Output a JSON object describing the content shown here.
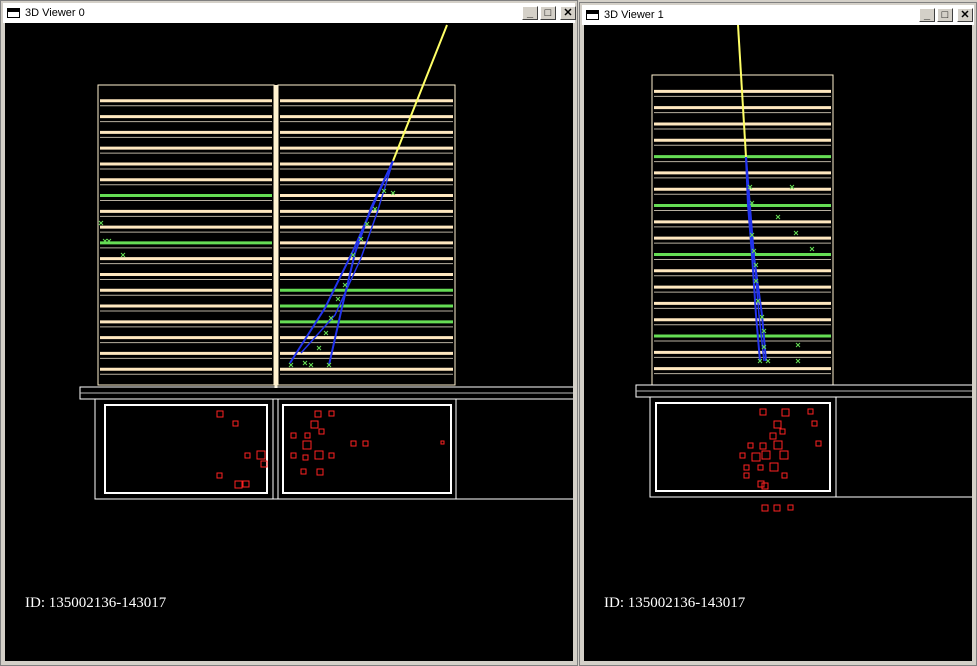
{
  "windows": [
    {
      "title": "3D Viewer 0",
      "id_text": "ID: 135002136-143017"
    },
    {
      "title": "3D Viewer 1",
      "id_text": "ID: 135002136-143017"
    }
  ],
  "titlebar_buttons": {
    "minimize": "_",
    "maximize": "□",
    "close": "✕"
  },
  "colors": {
    "background": "#000000",
    "detector_frame": "#fff2d0",
    "strip_bright": "#ffe8c0",
    "strip_hit": "#66dd55",
    "track": "#2233ee",
    "beam": "#ffff66",
    "calo_hit": "#ff2222",
    "window_chrome": "#d4d0c8"
  },
  "icons": [
    "window-app-icon",
    "minimize-icon",
    "maximize-icon",
    "close-icon"
  ]
}
